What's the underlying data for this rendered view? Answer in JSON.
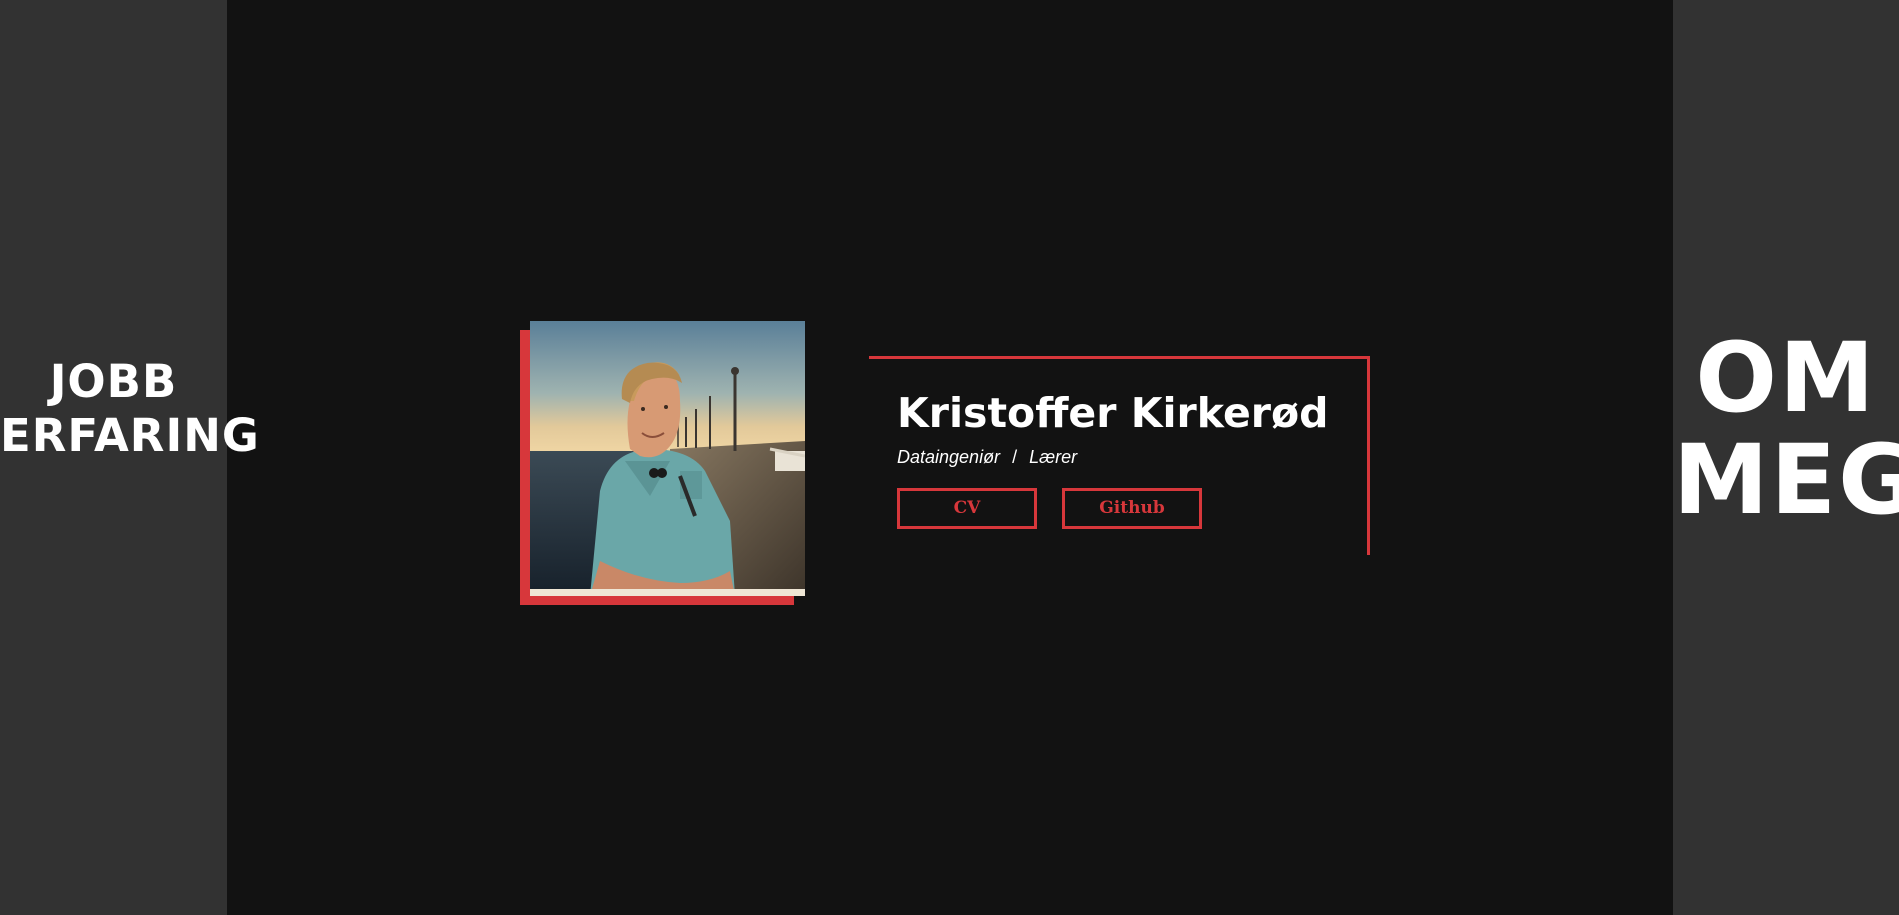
{
  "nav": {
    "left_label_line1": "JOBB",
    "left_label_line2": "ERFARING",
    "right_label_line1": "OM",
    "right_label_line2": "MEG"
  },
  "profile": {
    "name": "Kristoffer Kirkerød",
    "role1": "Dataingeniør",
    "role_separator": "/",
    "role2": "Lærer",
    "photo_icon": "profile-photo"
  },
  "buttons": {
    "cv_label": "CV",
    "github_label": "Github"
  },
  "colors": {
    "accent": "#d7373b",
    "background": "#121212",
    "sidebar": "#323232",
    "text": "#ffffff"
  }
}
